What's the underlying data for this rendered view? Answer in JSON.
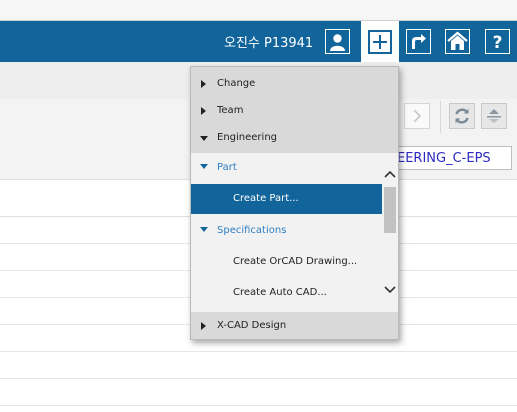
{
  "header": {
    "user_label": "오진수 P13941",
    "icons": [
      "user-icon",
      "plus-icon",
      "share-arrow-icon",
      "home-icon",
      "help-icon"
    ]
  },
  "toolbar": {
    "context_value": "EERING_C-EPS",
    "icons": [
      "chevron-right-icon",
      "refresh-icon",
      "sort-icon"
    ]
  },
  "menu": {
    "top_items": [
      {
        "label": "Change",
        "expanded": false
      },
      {
        "label": "Team",
        "expanded": false
      },
      {
        "label": "Engineering",
        "expanded": true
      }
    ],
    "submenu": [
      {
        "type": "header",
        "label": "Part"
      },
      {
        "type": "item",
        "label": "Create Part...",
        "selected": true
      },
      {
        "type": "header",
        "label": "Specifications"
      },
      {
        "type": "item",
        "label": "Create OrCAD Drawing..."
      },
      {
        "type": "item",
        "label": "Create Auto CAD..."
      }
    ],
    "bottom_item": {
      "label": "X-CAD Design",
      "expanded": false
    }
  },
  "colors": {
    "header_bg": "#11659b",
    "section_header_text": "#2f7fc4",
    "selected_bg": "#11659b",
    "context_text": "#2b2bc2"
  }
}
